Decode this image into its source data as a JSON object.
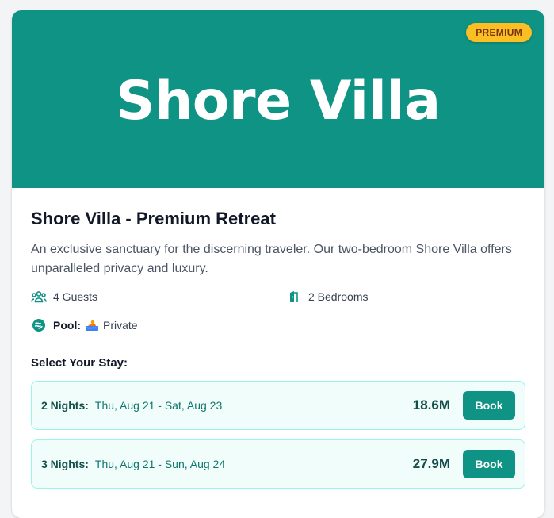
{
  "hero": {
    "title": "Shore Villa",
    "badge": "PREMIUM",
    "background_color": "#0e9384",
    "badge_color": "#fbbf24"
  },
  "listing": {
    "title": "Shore Villa - Premium Retreat",
    "description": "An exclusive sanctuary for the discerning traveler. Our two-bedroom Shore Villa offers unparalleled privacy and luxury."
  },
  "features": {
    "guests": {
      "icon": "users-icon",
      "label": "4 Guests"
    },
    "bedrooms": {
      "icon": "door-icon",
      "label": "2 Bedrooms"
    },
    "pool": {
      "icon": "pool-icon",
      "label": "Pool:",
      "emoji": "🏊",
      "value": "Private"
    }
  },
  "stay": {
    "heading": "Select Your Stay:",
    "options": [
      {
        "nights": "2 Nights:",
        "dates": "Thu, Aug 21 - Sat, Aug 23",
        "price": "18.6M",
        "button": "Book"
      },
      {
        "nights": "3 Nights:",
        "dates": "Thu, Aug 21 - Sun, Aug 24",
        "price": "27.9M",
        "button": "Book"
      }
    ]
  },
  "colors": {
    "accent": "#0e9384",
    "option_bg": "#f0fdfa",
    "option_border": "#99f6e4"
  }
}
